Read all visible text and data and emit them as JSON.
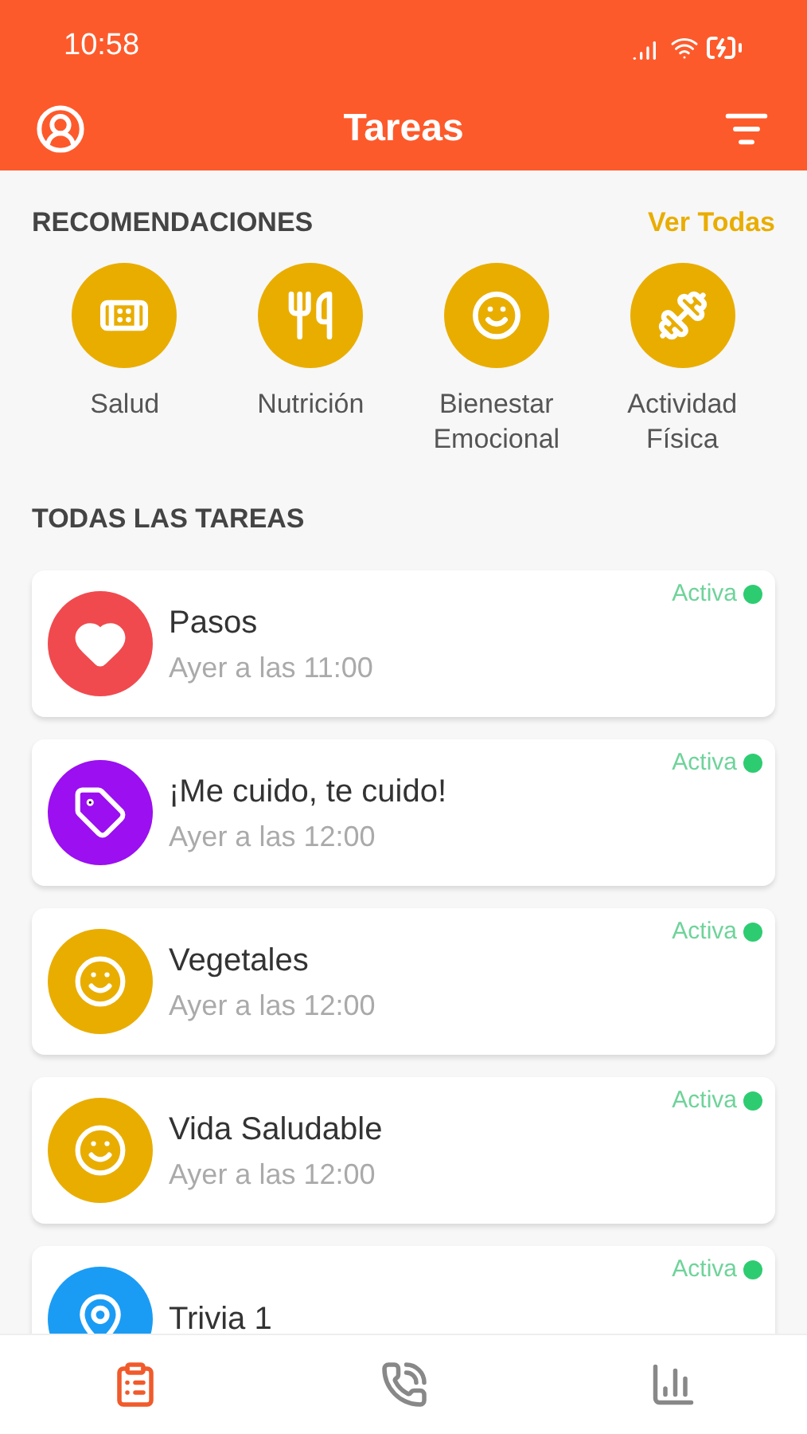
{
  "status_bar": {
    "time": "10:58"
  },
  "header": {
    "title": "Tareas"
  },
  "recommendations": {
    "title": "RECOMENDACIONES",
    "link": "Ver Todas",
    "items": [
      {
        "kind": "bandage",
        "label": "Salud"
      },
      {
        "kind": "utensils",
        "label": "Nutrición"
      },
      {
        "kind": "face",
        "label": "Bienestar Emocional"
      },
      {
        "kind": "dumbbell",
        "label": "Actividad Física"
      }
    ]
  },
  "tasks": {
    "title": "TODAS LAS TAREAS",
    "items": [
      {
        "kind": "heart",
        "color": "#f04a4f",
        "title": "Pasos",
        "subtitle": "Ayer a las 11:00",
        "status": "Activa",
        "active": true
      },
      {
        "kind": "tag",
        "color": "#9b0ff0",
        "title": "¡Me cuido, te cuido!",
        "subtitle": "Ayer a las 12:00",
        "status": "Activa",
        "active": true
      },
      {
        "kind": "face",
        "color": "#e9ad00",
        "title": "Vegetales",
        "subtitle": "Ayer a las 12:00",
        "status": "Activa",
        "active": true
      },
      {
        "kind": "face",
        "color": "#e9ad00",
        "title": "Vida Saludable",
        "subtitle": "Ayer a las 12:00",
        "status": "Activa",
        "active": true
      },
      {
        "kind": "pin",
        "color": "#1a9cf5",
        "title": "Trivia 1",
        "status": "Activa",
        "active": true
      }
    ]
  },
  "tab_bar": [
    {
      "kind": "tasks",
      "selected": true
    },
    {
      "kind": "calls",
      "selected": false
    },
    {
      "kind": "stats",
      "selected": false
    }
  ]
}
